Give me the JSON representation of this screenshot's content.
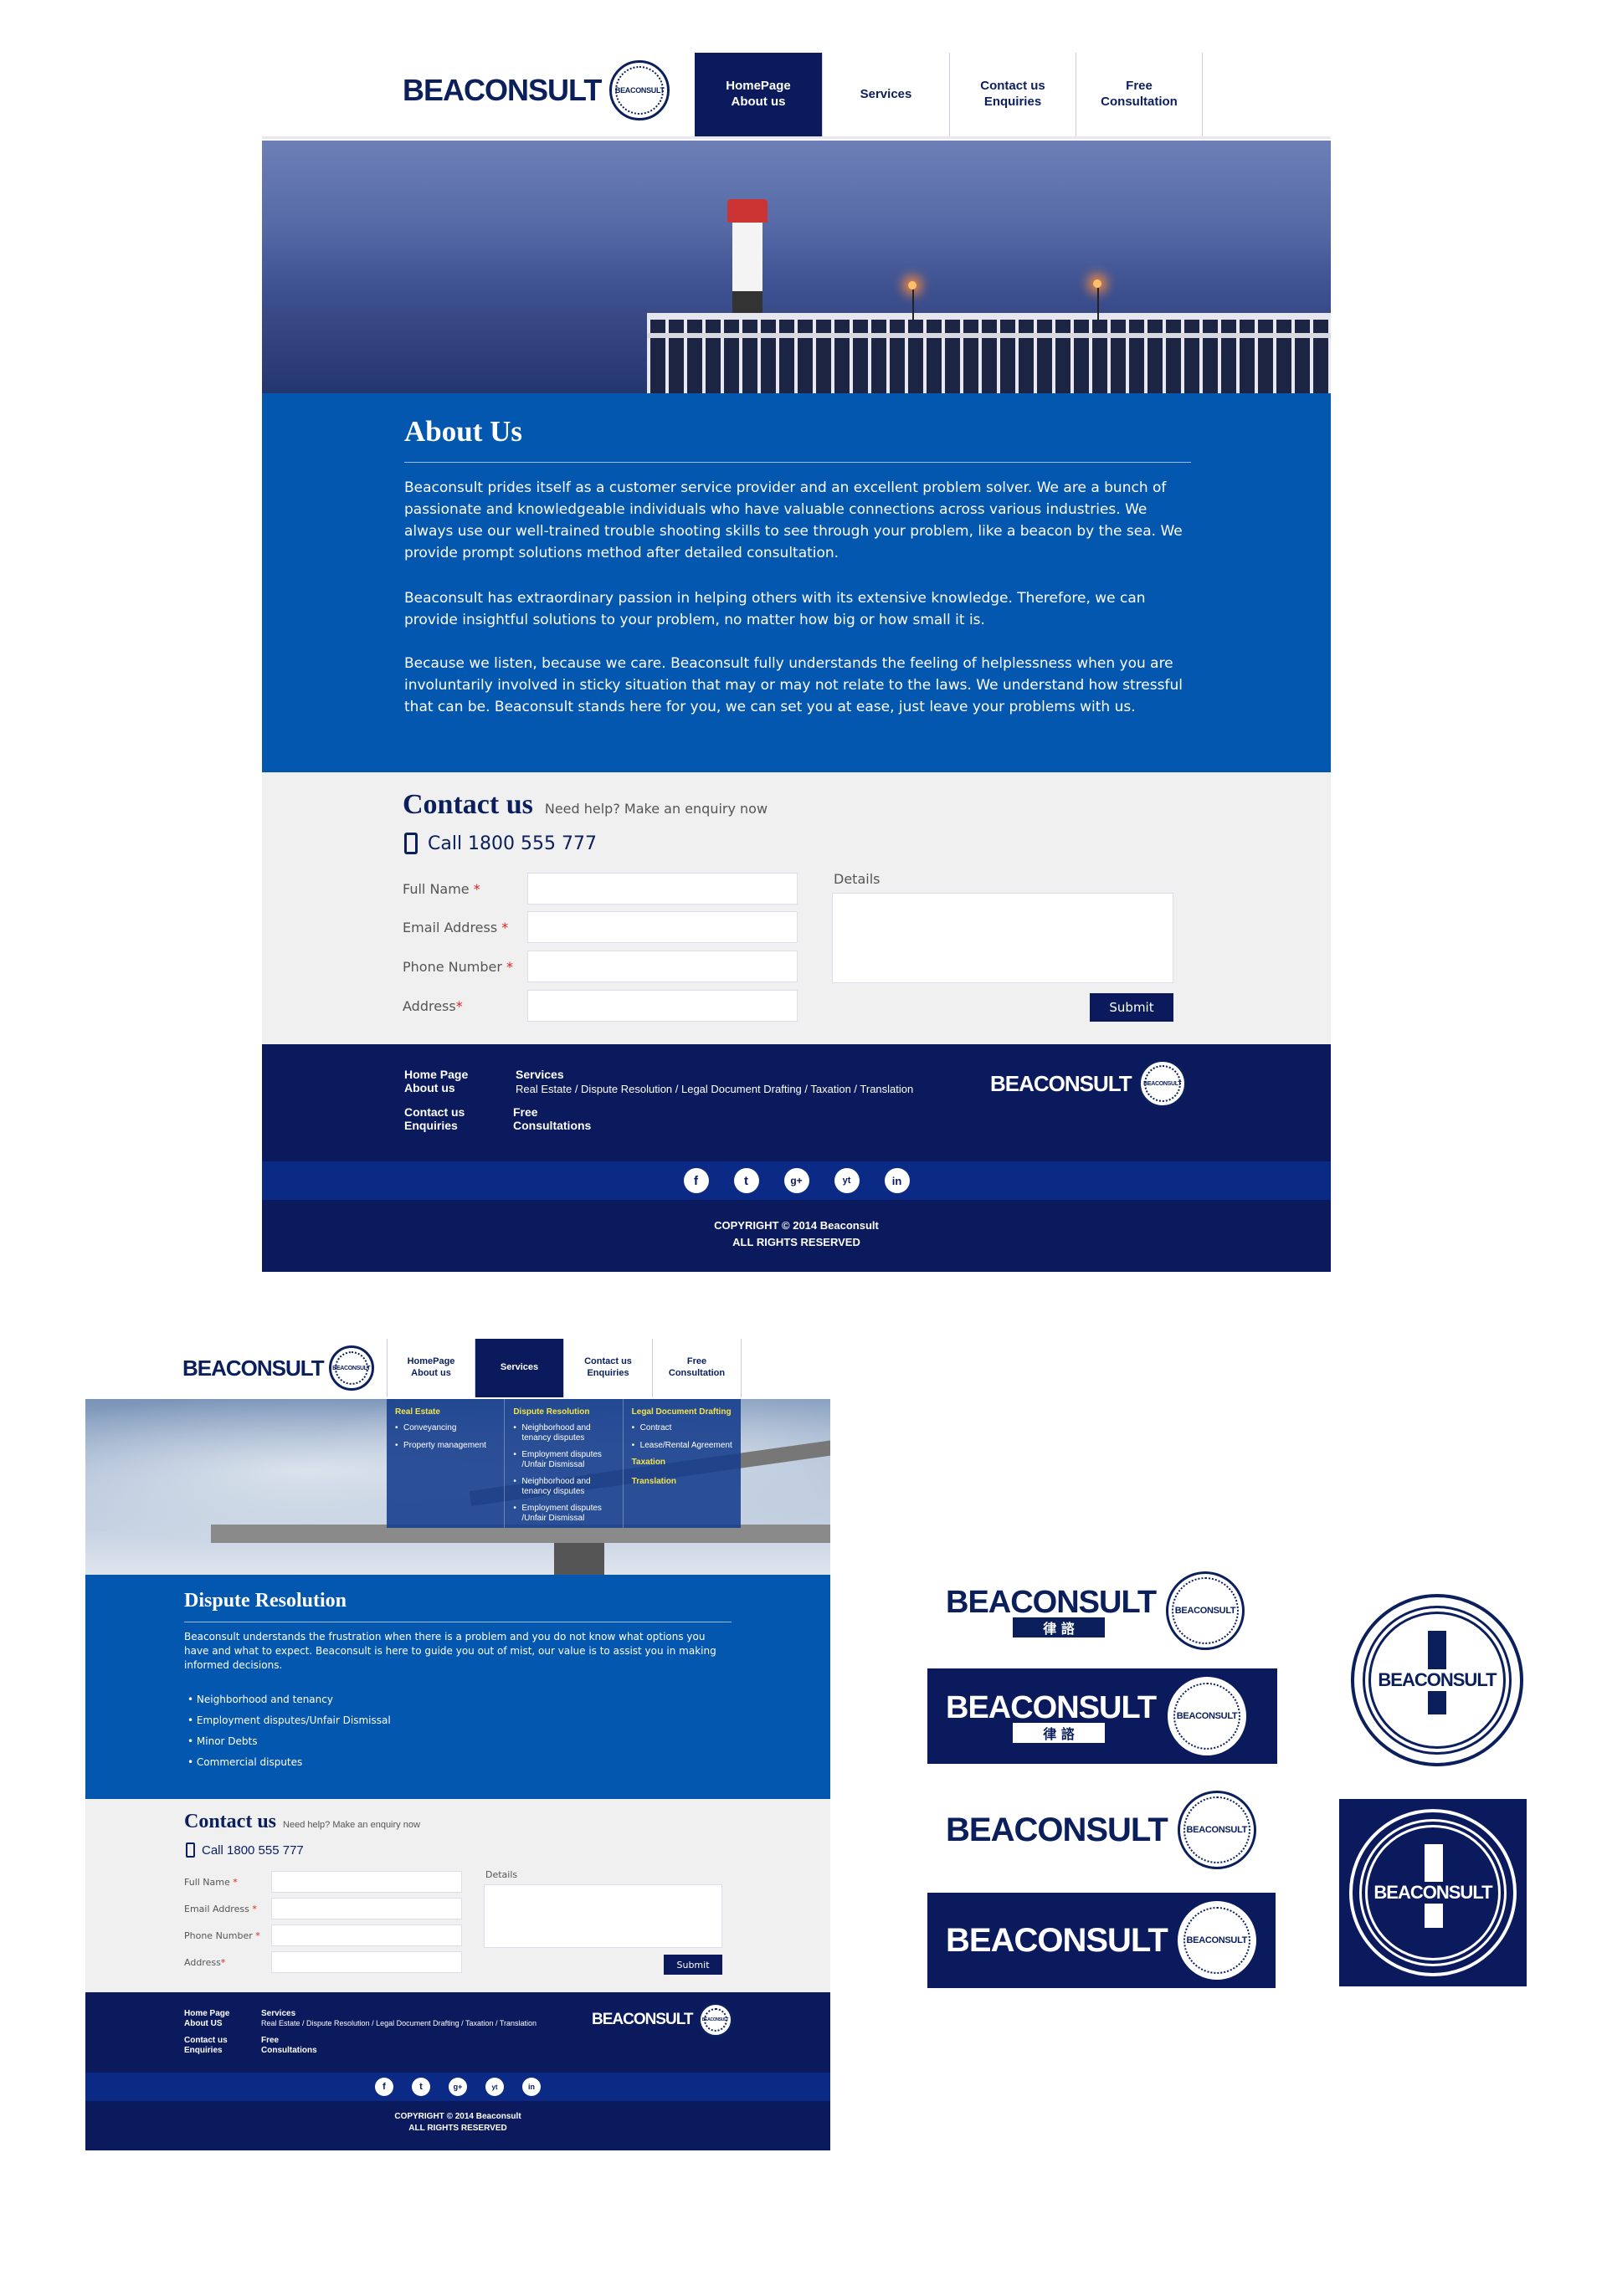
{
  "brand": {
    "name": "BEACONSULT",
    "seal_text": "BEACONSULT",
    "chinese": "律 諮"
  },
  "nav": [
    {
      "label": "HomePage\nAbout us"
    },
    {
      "label": "Services"
    },
    {
      "label": "Contact us\nEnquiries"
    },
    {
      "label": "Free\nConsultation"
    }
  ],
  "nav2": [
    {
      "label": "HomePage\nAbout us"
    },
    {
      "label": "Services"
    },
    {
      "label": "Contact us\nEnquiries"
    },
    {
      "label": "Free\nConsultation"
    }
  ],
  "about": {
    "title": "About Us",
    "p1": "Beaconsult prides itself as a customer service provider and an excellent problem solver. We are a bunch of passionate and knowledgeable individuals who have valuable connections across various industries. We always use our well-trained trouble shooting skills to see through your problem, like a beacon by the sea. We provide prompt solutions method after detailed consultation.",
    "p2": "Beaconsult has extraordinary passion in helping others with its extensive knowledge. Therefore, we can provide insightful solutions to your problem, no matter how big or how small it is.",
    "p3": "Because we listen, because we care. Beaconsult fully understands the feeling of helplessness when you are involuntarily involved in sticky situation that may or may not relate to the laws. We understand how stressful that can be. Beaconsult stands here for you, we can set you at ease, just leave your problems with us."
  },
  "contact": {
    "title": "Contact us",
    "subtitle": "Need help? Make an enquiry now",
    "phone": "Call 1800 555 777",
    "full_name": "Full Name",
    "email": "Email Address",
    "phone_number": "Phone Number",
    "address": "Address",
    "required_mark": "*",
    "details": "Details",
    "submit": "Submit"
  },
  "footer": {
    "home": "Home Page\nAbout us",
    "services": "Services",
    "services_list": "Real Estate / Dispute Resolution / Legal Document Drafting / Taxation / Translation",
    "contact": "Contact us\nEnquiries",
    "free": "Free\nConsultations",
    "copyright": "COPYRIGHT © 2014 Beaconsult\nALL RIGHTS RESERVED"
  },
  "footer2": {
    "home": "Home Page\nAbout US",
    "contact": "Contact us\nEnquiries"
  },
  "social": [
    "f",
    "t",
    "g+",
    "yt",
    "in"
  ],
  "dropdown": {
    "real_estate": "Real Estate",
    "re_items": [
      "Conveyancing",
      "Property management"
    ],
    "dispute": "Dispute Resolution",
    "dispute_items": [
      "Neighborhood and tenancy disputes",
      "Employment disputes /Unfair Dismissal",
      "Neighborhood and tenancy disputes",
      "Employment disputes /Unfair Dismissal"
    ],
    "legal": "Legal Document Drafting",
    "legal_items": [
      "Contract",
      "Lease/Rental Agreement"
    ],
    "taxation": "Taxation",
    "translation": "Translation"
  },
  "dispute": {
    "title": "Dispute Resolution",
    "p1": "Beaconsult understands the frustration when there is a problem and you do not know what options you have and what to expect. Beaconsult is here to guide you out of mist, our value is to assist you in making informed decisions.",
    "items": [
      "Neighborhood and tenancy",
      "Employment disputes/Unfair Dismissal",
      "Minor Debts",
      "Commercial disputes"
    ]
  },
  "colors": {
    "navy": "#0a1a5c",
    "blue": "#0457ae",
    "accent_yellow": "#f2e44b"
  }
}
